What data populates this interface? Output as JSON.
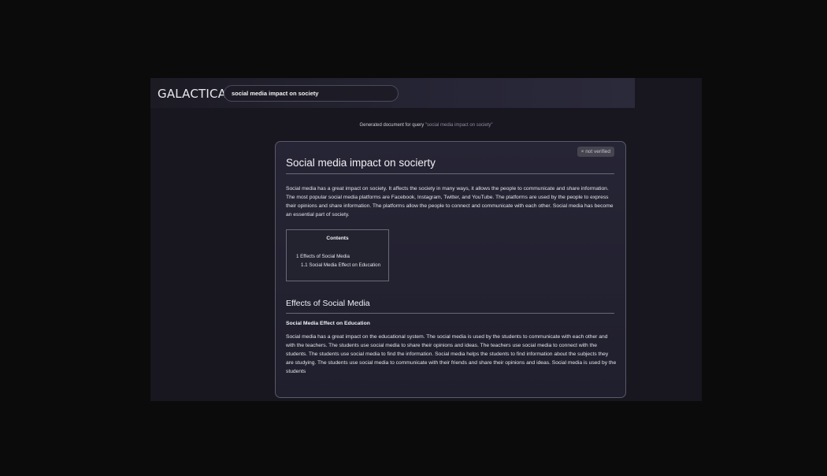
{
  "app": {
    "logo": "GALACTICA"
  },
  "search": {
    "value": "social media impact on society"
  },
  "generated": {
    "prefix": "Generated document for query ",
    "query": "\"social media impact on society\""
  },
  "document": {
    "badge": "× not verified",
    "title": "Social media impact on socierty",
    "intro": "Social media has a great impact on society. It affects the society in many ways, it allows the people to communicate and share information. The most popular social media platforms are Facebook, Instagram, Twitter, and YouTube. The platforms are used by the people to express their opinions and share information. The platforms allow the people to connect and communicate with each other. Social media has become an essential part of society.",
    "toc": {
      "title": "Contents",
      "items": [
        "1 Effects of Social Media",
        "1.1 Social Media Effect on Education"
      ]
    },
    "section": {
      "heading": "Effects of Social Media",
      "subheading": "Social Media Effect on Education",
      "body": "Social media has a great impact on the educational system. The social media is used by the students to communicate with each other and with the teachers. The students use social media to share their opinions and ideas. The teachers use social media to connect with the students. The students use social media to find the information. Social media helps the students to find information about the subjects they are studying. The students use social media to communicate with their friends and share their opinions and ideas. Social media is used by the students"
    }
  }
}
